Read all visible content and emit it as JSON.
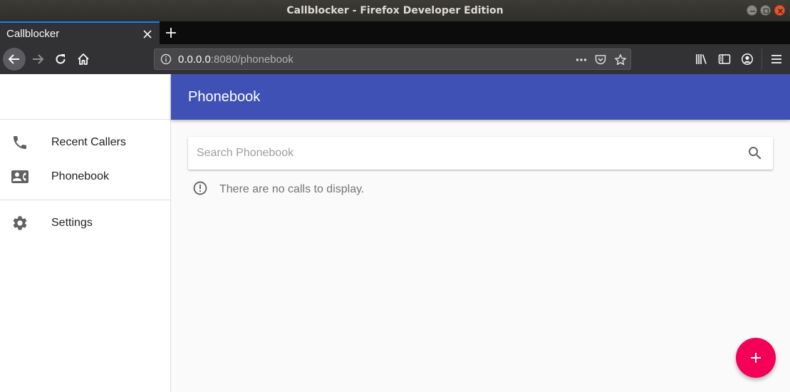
{
  "window": {
    "title": "Callblocker - Firefox Developer Edition"
  },
  "browser": {
    "tab_title": "Callblocker",
    "url_host": "0.0.0.0",
    "url_rest": ":8080/phonebook"
  },
  "drawer": {
    "items": [
      {
        "label": "Recent Callers",
        "icon": "phone-icon"
      },
      {
        "label": "Phonebook",
        "icon": "contact-card-icon"
      },
      {
        "label": "Settings",
        "icon": "gear-icon"
      }
    ]
  },
  "appbar": {
    "title": "Phonebook",
    "color": "#3f51b5"
  },
  "search": {
    "placeholder": "Search Phonebook",
    "value": ""
  },
  "empty_state": {
    "message": "There are no calls to display."
  },
  "fab": {
    "icon": "plus-icon",
    "color": "#f50057"
  }
}
